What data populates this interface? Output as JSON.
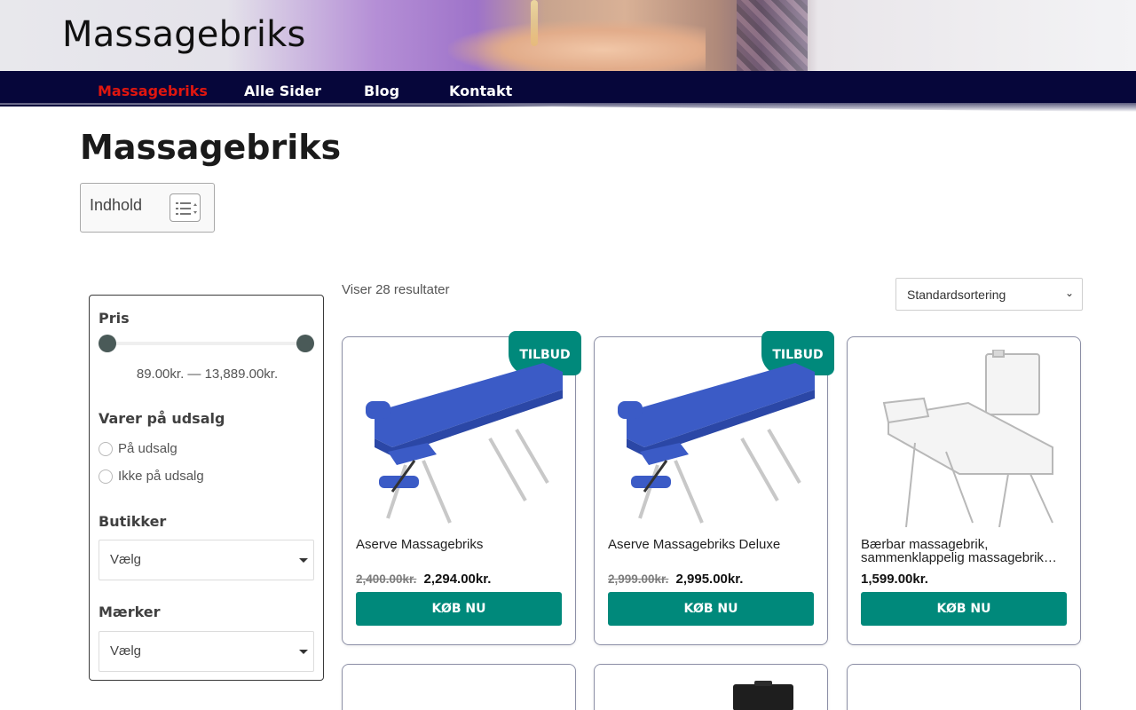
{
  "site": {
    "title": "Massagebriks"
  },
  "nav": {
    "items": [
      {
        "label": "Massagebriks",
        "active": true
      },
      {
        "label": "Alle Sider",
        "active": false
      },
      {
        "label": "Blog",
        "active": false
      },
      {
        "label": "Kontakt",
        "active": false
      }
    ]
  },
  "page": {
    "title": "Massagebriks"
  },
  "toc": {
    "label": "Indhold"
  },
  "filters": {
    "price": {
      "heading": "Pris",
      "range_text": "89.00kr. — 13,889.00kr.",
      "min": 89.0,
      "max": 13889.0
    },
    "sale": {
      "heading": "Varer på udsalg",
      "options": [
        "På udsalg",
        "Ikke på udsalg"
      ]
    },
    "stores": {
      "heading": "Butikker",
      "placeholder": "Vælg"
    },
    "brands": {
      "heading": "Mærker",
      "placeholder": "Vælg"
    }
  },
  "results": {
    "count_text": "Viser 28 resultater",
    "sort_value": "Standardsortering"
  },
  "products": [
    {
      "name": "Aserve Massagebriks",
      "old_price": "2,400.00kr.",
      "price": "2,294.00kr.",
      "badge": "TILBUD",
      "button": "KØB NU"
    },
    {
      "name": "Aserve Massagebriks Deluxe",
      "old_price": "2,999.00kr.",
      "price": "2,995.00kr.",
      "badge": "TILBUD",
      "button": "KØB NU"
    },
    {
      "name": "Bærbar massagebrik, sammenklappelig massagebrik…",
      "old_price": "",
      "price": "1,599.00kr.",
      "badge": "",
      "button": "KØB NU"
    }
  ],
  "colors": {
    "accent": "#00897b",
    "nav_bg": "#06063a",
    "nav_active": "#e0160f",
    "table_blue": "#3b5bc6"
  }
}
